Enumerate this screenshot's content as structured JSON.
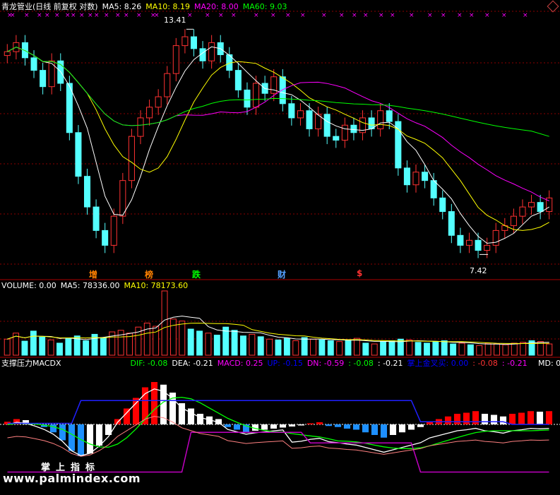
{
  "header": {
    "stock": "青龙管业(日线 前复权 对数)",
    "ma5": "MA5: 8.26",
    "ma10": "MA10: 8.19",
    "ma20": "MA20: 8.00",
    "ma60": "MA60: 9.03"
  },
  "volume_header": {
    "volume": "VOLUME: 0.00",
    "ma5": "MA5: 78336.00",
    "ma10": "MA10: 78173.60"
  },
  "macd_header": {
    "name": "支撑压力MACDX",
    "dif": "DIF: -0.08",
    "dea": "DEA: -0.21",
    "macd": "MACD: 0.25",
    "up": "UP: -0.15",
    "dn": "DN: -0.59",
    "v1": ": -0.08",
    "v2": ": -0.21",
    "sig": "掌上金叉买: 0.00",
    "v3": ": -0.08",
    "v4": ": -0.21",
    "md": "MD: 0"
  },
  "annotations": {
    "high": "13.41",
    "low": "7.42",
    "events": [
      "增",
      "榜",
      "跌",
      "财",
      "$"
    ]
  },
  "watermark": {
    "site": "www.palmindex.com",
    "label": "掌上指标"
  },
  "colors": {
    "up": "#ff3232",
    "down": "#54ffff",
    "ma5": "#ffffff",
    "ma10": "#ffff00",
    "ma20": "#ff00ff",
    "ma60": "#00ff00",
    "grid": "#8b0000"
  },
  "chart_data": [
    {
      "type": "candlestick",
      "title": "青龙管业(日线 前复权 对数)",
      "ylim": [
        7.0,
        14.0
      ],
      "log_scale": true,
      "grid": true,
      "high": 13.41,
      "low": 7.42,
      "series": [
        {
          "name": "MA5",
          "last": 8.26
        },
        {
          "name": "MA10",
          "last": 8.19
        },
        {
          "name": "MA20",
          "last": 8.0
        },
        {
          "name": "MA60",
          "last": 9.03
        }
      ],
      "close_path": [
        12.6,
        12.9,
        12.4,
        12.0,
        11.5,
        12.3,
        11.6,
        10.2,
        9.1,
        8.4,
        7.9,
        7.6,
        8.2,
        9.0,
        10.1,
        10.6,
        10.9,
        11.2,
        11.9,
        12.8,
        13.1,
        12.7,
        12.3,
        12.9,
        12.5,
        12.0,
        11.4,
        10.9,
        11.6,
        11.3,
        11.8,
        11.0,
        10.6,
        10.8,
        10.3,
        10.7,
        10.1,
        10.0,
        10.4,
        10.2,
        10.6,
        10.3,
        10.8,
        10.5,
        9.3,
        8.9,
        9.2,
        9.0,
        8.6,
        8.3,
        7.8,
        7.6,
        7.7,
        7.5,
        7.6,
        7.9,
        8.0,
        8.2,
        8.4,
        8.5,
        8.3,
        8.6
      ]
    },
    {
      "type": "bar",
      "title": "VOLUME",
      "series": [
        {
          "name": "MA5",
          "last": 78336.0
        },
        {
          "name": "MA10",
          "last": 78173.6
        }
      ],
      "values": [
        40,
        55,
        35,
        60,
        45,
        38,
        30,
        42,
        48,
        36,
        52,
        44,
        58,
        62,
        55,
        70,
        80,
        72,
        160,
        90,
        85,
        65,
        60,
        55,
        50,
        70,
        62,
        48,
        52,
        46,
        40,
        38,
        42,
        36,
        44,
        40,
        38,
        36,
        34,
        38,
        42,
        30,
        28,
        34,
        36,
        40,
        38,
        32,
        30,
        34,
        36,
        28,
        30,
        26,
        24,
        30,
        28,
        26,
        30,
        32,
        36,
        34,
        28
      ]
    },
    {
      "type": "bar",
      "title": "支撑压力MACDX",
      "series": [
        {
          "name": "DIF",
          "last": -0.08
        },
        {
          "name": "DEA",
          "last": -0.21
        },
        {
          "name": "MACD",
          "last": 0.25
        },
        {
          "name": "UP",
          "last": -0.15
        },
        {
          "name": "DN",
          "last": -0.59
        }
      ],
      "values": [
        0.05,
        0.1,
        0.08,
        0.02,
        -0.05,
        -0.15,
        -0.3,
        -0.5,
        -0.6,
        -0.55,
        -0.4,
        -0.2,
        0.1,
        0.3,
        0.5,
        0.7,
        0.8,
        0.75,
        0.6,
        0.4,
        0.3,
        0.2,
        0.15,
        0.1,
        -0.05,
        -0.1,
        -0.15,
        -0.12,
        -0.1,
        -0.08,
        -0.06,
        -0.04,
        -0.02,
        0.02,
        0.04,
        -0.03,
        -0.05,
        -0.08,
        -0.1,
        -0.15,
        -0.2,
        -0.25,
        -0.2,
        -0.15,
        -0.1,
        -0.05,
        0.05,
        0.1,
        0.15,
        0.2,
        0.22,
        0.25,
        0.2,
        0.18,
        0.15,
        0.2,
        0.22,
        0.25,
        0.24,
        0.25
      ]
    }
  ]
}
